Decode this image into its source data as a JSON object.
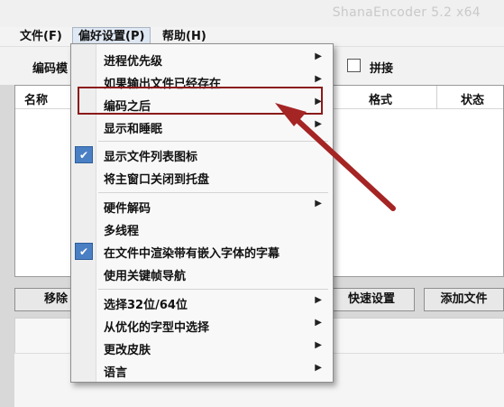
{
  "window": {
    "title": "ShanaEncoder 5.2 x64"
  },
  "menubar": {
    "file": "文件(F)",
    "preferences": "偏好设置(P)",
    "help": "帮助(H)"
  },
  "toolbar": {
    "encode_label": "编码模",
    "concat_label": "拼接"
  },
  "list": {
    "col_name": "名称",
    "col_format": "格式",
    "col_status": "状态"
  },
  "buttons": {
    "remove": "移除",
    "quick_settings": "快速设置",
    "add_file": "添加文件"
  },
  "dropdown": {
    "items": [
      {
        "label": "进程优先级",
        "submenu": true
      },
      {
        "label": "如果输出文件已经存在",
        "submenu": true
      },
      {
        "label": "编码之后",
        "submenu": true
      },
      {
        "label": "显示和睡眠",
        "submenu": true
      },
      {
        "label": "显示文件列表图标",
        "checked": true
      },
      {
        "label": "将主窗口关闭到托盘"
      },
      {
        "label": "硬件解码",
        "submenu": true
      },
      {
        "label": "多线程"
      },
      {
        "label": "在文件中渲染带有嵌入字体的字幕",
        "checked": true
      },
      {
        "label": "使用关键帧导航"
      },
      {
        "label": "选择32位/64位",
        "submenu": true
      },
      {
        "label": "从优化的字型中选择",
        "submenu": true
      },
      {
        "label": "更改皮肤",
        "submenu": true
      },
      {
        "label": "语言",
        "submenu": true
      }
    ]
  },
  "colors": {
    "accent": "#4a7fc4",
    "annotation": "#8b1a1a"
  }
}
